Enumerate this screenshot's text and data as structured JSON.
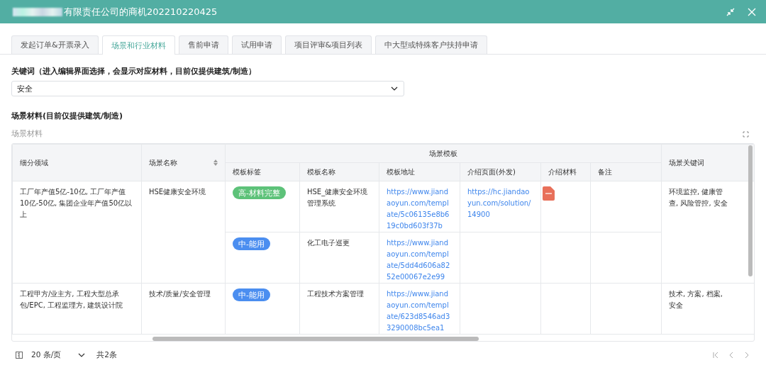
{
  "window": {
    "title": "有限责任公司的商机202210220425"
  },
  "tabs": [
    {
      "label": "发起订单&开票录入",
      "selected": false
    },
    {
      "label": "场景和行业材料",
      "selected": true
    },
    {
      "label": "售前申请",
      "selected": false
    },
    {
      "label": "试用申请",
      "selected": false
    },
    {
      "label": "项目评审&项目列表",
      "selected": false
    },
    {
      "label": "中大型或特殊客户扶持申请",
      "selected": false
    }
  ],
  "keyword": {
    "label": "关键词（进入编辑界面选择，会显示对应材料，目前仅提供建筑/制造）",
    "value": "安全"
  },
  "materials": {
    "heading": "场景材料(目前仅提供建筑/制造)",
    "field_label": "场景材料"
  },
  "table": {
    "columns": {
      "segment": "细分领域",
      "scene": "场景名称",
      "group": "场景模板",
      "tag": "模板标签",
      "name": "模板名称",
      "url": "模板地址",
      "intro_page": "介绍页面(外发)",
      "intro_material": "介绍材料",
      "note": "备注",
      "keywords": "场景关键词"
    },
    "rows": [
      {
        "segment": "工厂年产值5亿-10亿, 工厂年产值10亿-50亿, 集团企业年产值50亿以上",
        "scene": "HSE健康安全环境",
        "keywords_lines": [
          "环境监控, 健康管",
          "查, 风险管控, 安全"
        ],
        "templates": [
          {
            "tag": "高-材料完整",
            "color": "#5dc279",
            "name": "HSE_健康安全环境管理系统",
            "url": "https://www.jiandaoyun.com/template/5c06135e8b619c0bd603f37b",
            "intro_page": "https://hc.jiandaoyun.com/solution/14900",
            "pdf": true
          },
          {
            "tag": "中-能用",
            "color": "#4b8ef0",
            "name": "化工电子巡更",
            "url": "https://www.jiandaoyun.com/template/5dd4d606a8252e00067e2e99",
            "pdf": false
          }
        ]
      },
      {
        "segment": "工程甲方/业主方, 工程大型总承包/EPC, 工程监理方, 建筑设计院",
        "scene": "技术/质量/安全管理",
        "keywords_lines": [
          "技术, 方案, 档案,",
          "安全"
        ],
        "templates": [
          {
            "tag": "中-能用",
            "color": "#4b8ef0",
            "name": "工程技术方案管理",
            "url": "https://www.jiandaoyun.com/template/623d8546ad33290008bc5ea1",
            "pdf": false
          }
        ]
      }
    ]
  },
  "pagination": {
    "page_size": "20 条/页",
    "total": "共2条"
  }
}
